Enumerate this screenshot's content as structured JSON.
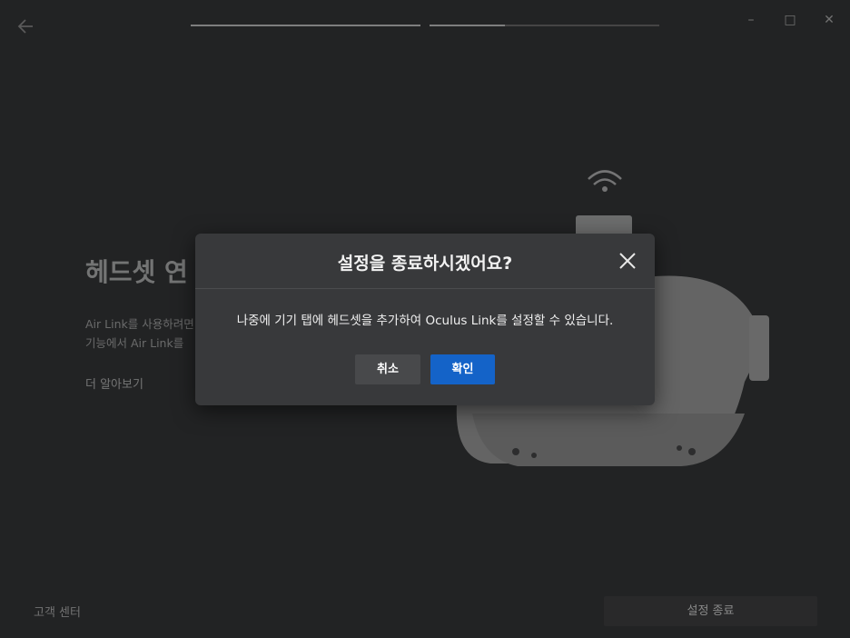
{
  "header": {
    "back_icon": "arrow-left-icon",
    "progress": [
      1.0,
      0.33
    ],
    "window_controls": {
      "minimize": "–",
      "maximize": "□",
      "close": "✕"
    }
  },
  "main": {
    "title": "헤드셋 연",
    "description_line1": "Air Link를 사용하려면",
    "description_line2": "기능에서 Air Link를",
    "learn_more": "더 알아보기"
  },
  "footer": {
    "support_label": "고객 센터",
    "exit_setup_label": "설정 종료"
  },
  "dialog": {
    "title": "설정을 종료하시겠어요?",
    "message": "나중에 기기 탭에 헤드셋을 추가하여 Oculus Link를 설정할 수 있습니다.",
    "cancel_label": "취소",
    "confirm_label": "확인",
    "accent": "#1463c8"
  }
}
